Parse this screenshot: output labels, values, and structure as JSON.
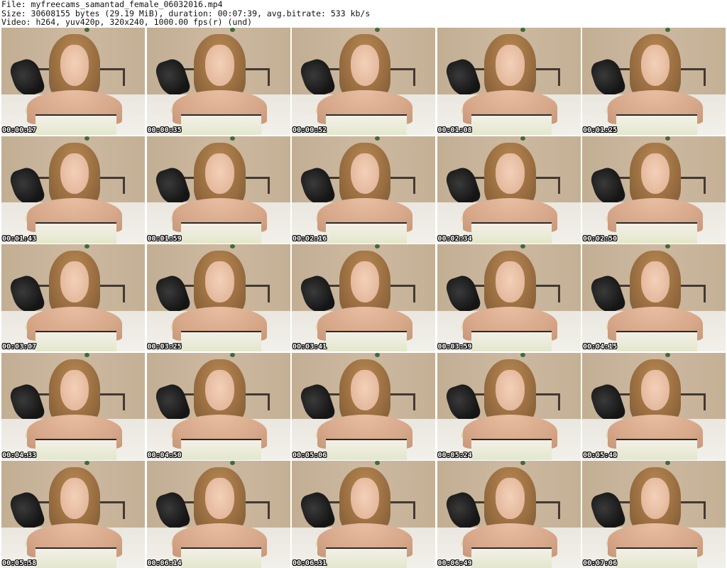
{
  "header": {
    "file_line": "File: myfreecams_samantad_female_06032016.mp4",
    "size_line": "Size: 30608155 bytes (29.19 MiB), duration: 00:07:39, avg.bitrate: 533 kb/s",
    "video_line": "Video: h264, yuv420p, 320x240, 1000.00 fps(r) (und)"
  },
  "thumbnails": [
    {
      "timestamp": "00:00:17"
    },
    {
      "timestamp": "00:00:35"
    },
    {
      "timestamp": "00:00:52"
    },
    {
      "timestamp": "00:01:08"
    },
    {
      "timestamp": "00:01:25"
    },
    {
      "timestamp": "00:01:43"
    },
    {
      "timestamp": "00:01:59"
    },
    {
      "timestamp": "00:02:16"
    },
    {
      "timestamp": "00:02:34"
    },
    {
      "timestamp": "00:02:50"
    },
    {
      "timestamp": "00:03:07"
    },
    {
      "timestamp": "00:03:25"
    },
    {
      "timestamp": "00:03:41"
    },
    {
      "timestamp": "00:03:59"
    },
    {
      "timestamp": "00:04:15"
    },
    {
      "timestamp": "00:04:33"
    },
    {
      "timestamp": "00:04:50"
    },
    {
      "timestamp": "00:05:06"
    },
    {
      "timestamp": "00:05:24"
    },
    {
      "timestamp": "00:05:40"
    },
    {
      "timestamp": "00:05:58"
    },
    {
      "timestamp": "00:06:14"
    },
    {
      "timestamp": "00:06:31"
    },
    {
      "timestamp": "00:06:49"
    },
    {
      "timestamp": "00:07:06"
    }
  ]
}
